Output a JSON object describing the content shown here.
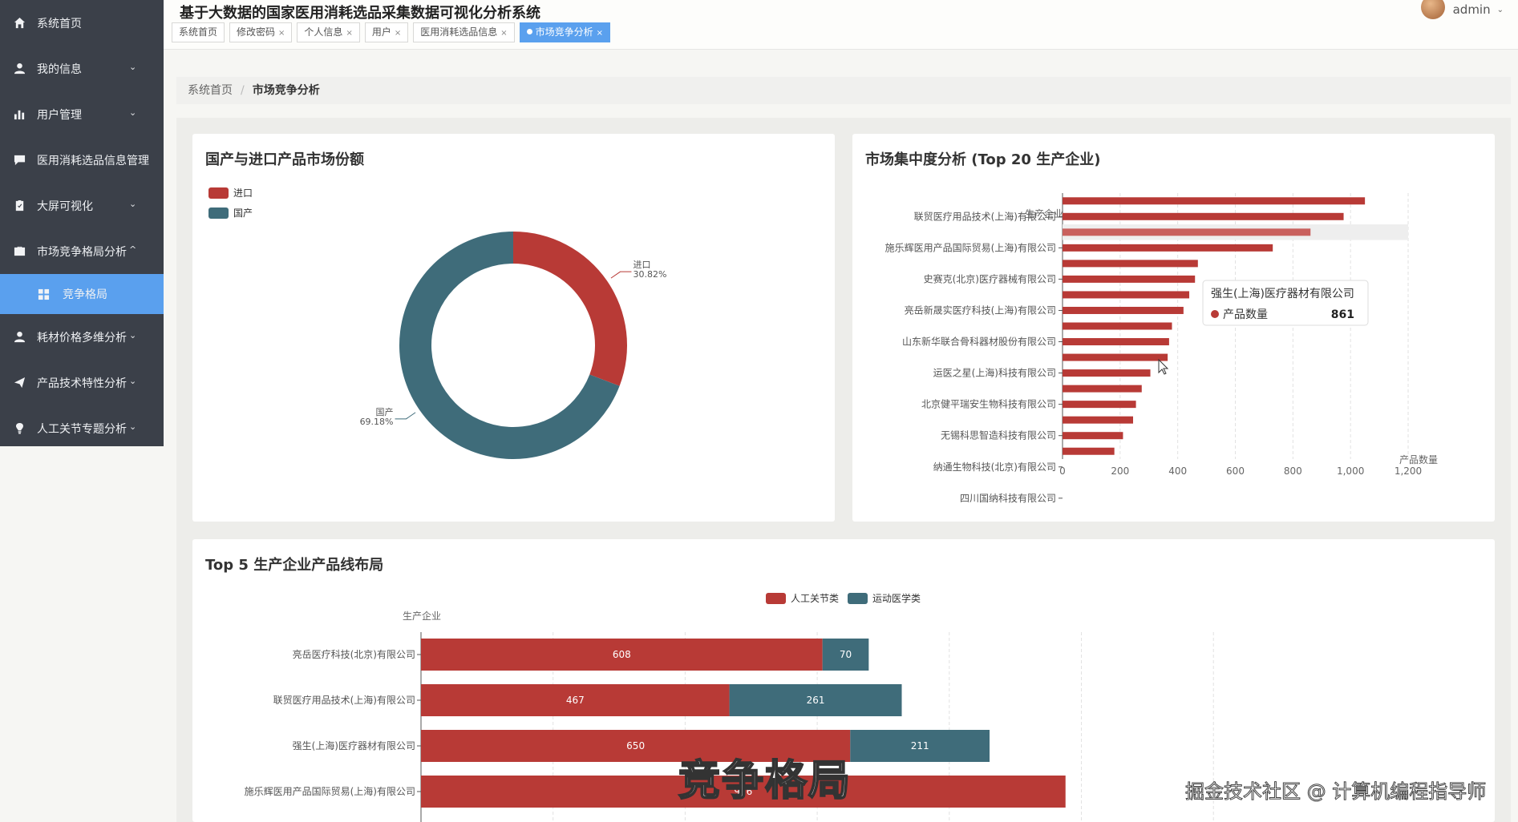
{
  "app": {
    "title": "基于大数据的国家医用消耗选品采集数据可视化分析系统"
  },
  "user": {
    "name": "admin",
    "caret": "⌄"
  },
  "sidebar": {
    "items": [
      {
        "label": "系统首页",
        "icon": "home-icon",
        "chevron": ""
      },
      {
        "label": "我的信息",
        "icon": "person-icon",
        "chevron": "⌄"
      },
      {
        "label": "用户管理",
        "icon": "bar-chart-icon",
        "chevron": "⌄"
      },
      {
        "label": "医用消耗选品信息管理",
        "icon": "message-icon",
        "chevron": ""
      },
      {
        "label": "大屏可视化",
        "icon": "clipboard-icon",
        "chevron": "⌄"
      },
      {
        "label": "市场竞争格局分析",
        "icon": "briefcase-icon",
        "chevron": "^"
      },
      {
        "label": "竞争格局",
        "icon": "grid-icon",
        "chevron": ""
      },
      {
        "label": "耗材价格多维分析",
        "icon": "person-icon",
        "chevron": "⌄"
      },
      {
        "label": "产品技术特性分析",
        "icon": "send-icon",
        "chevron": "⌄"
      },
      {
        "label": "人工关节专题分析",
        "icon": "bulb-icon",
        "chevron": "⌄"
      }
    ]
  },
  "tabs": [
    {
      "label": "系统首页",
      "close": ""
    },
    {
      "label": "修改密码",
      "close": "×"
    },
    {
      "label": "个人信息",
      "close": "×"
    },
    {
      "label": "用户",
      "close": "×"
    },
    {
      "label": "医用消耗选品信息",
      "close": "×"
    },
    {
      "label": "市场竞争分析",
      "close": "×"
    }
  ],
  "breadcrumb": {
    "home": "系统首页",
    "sep": "/",
    "current": "市场竞争分析"
  },
  "cards": {
    "pie_title": "国产与进口产品市场份额",
    "bar_title": "市场集中度分析 (Top 20 生产企业)",
    "stack_title": "Top 5 生产企业产品线布局"
  },
  "tooltip": {
    "company": "强生(上海)医疗器材有限公司",
    "series": "产品数量",
    "value": "861"
  },
  "overlay": {
    "caption": "竞争格局",
    "watermark": "掘金技术社区 @ 计算机编程指导师"
  },
  "colors": {
    "red": "#b83a36",
    "teal": "#3f6c7a",
    "accent": "#5aa0ee",
    "sidebar": "#3b4049"
  },
  "chart_data": [
    {
      "type": "pie",
      "title": "国产与进口产品市场份额",
      "legend": [
        "进口",
        "国产"
      ],
      "slices": [
        {
          "name": "进口",
          "value": 30.82,
          "label": "30.82%"
        },
        {
          "name": "国产",
          "value": 69.18,
          "label": "69.18%"
        }
      ],
      "legend_position": "top-left",
      "donut": true
    },
    {
      "type": "bar",
      "title": "市场集中度分析 (Top 20 生产企业)",
      "orientation": "horizontal",
      "ylabel": "生产企业",
      "xlabel": "产品数量",
      "xlim": [
        0,
        1200
      ],
      "xticks": [
        "0",
        "200",
        "400",
        "600",
        "800",
        "1,000",
        "1,200"
      ],
      "category_labels": [
        "联贸医疗用品技术(上海)有限公司",
        "施乐辉医用产品国际贸易(上海)有限公司",
        "史赛克(北京)医疗器械有限公司",
        "亮岳新晟实医疗科技(上海)有限公司",
        "山东新华联合骨科器材股份有限公司",
        "运医之星(上海)科技有限公司",
        "北京健平瑞安生物科技有限公司",
        "无锡科思智造科技有限公司",
        "纳通生物科技(北京)有限公司",
        "四川国纳科技有限公司"
      ],
      "values": [
        1050,
        976,
        861,
        730,
        470,
        460,
        440,
        420,
        380,
        370,
        365,
        305,
        275,
        255,
        245,
        210,
        180
      ],
      "highlight_index": 2,
      "series_name": "产品数量"
    },
    {
      "type": "bar",
      "title": "Top 5 生产企业产品线布局",
      "orientation": "horizontal",
      "stacked": true,
      "ylabel": "生产企业",
      "legend": [
        "人工关节类",
        "运动医学类"
      ],
      "legend_position": "top-center",
      "categories": [
        "亮岳医疗科技(北京)有限公司",
        "联贸医疗用品技术(上海)有限公司",
        "强生(上海)医疗器材有限公司",
        "施乐辉医用产品国际贸易(上海)有限公司"
      ],
      "series": [
        {
          "name": "人工关节类",
          "values": [
            608,
            467,
            650,
            976
          ],
          "labels": [
            "608",
            "467",
            "650",
            "976"
          ]
        },
        {
          "name": "运动医学类",
          "values": [
            70,
            261,
            211,
            0
          ],
          "labels": [
            "70",
            "261",
            "211",
            ""
          ]
        }
      ],
      "xlim": [
        0,
        1200
      ]
    }
  ]
}
